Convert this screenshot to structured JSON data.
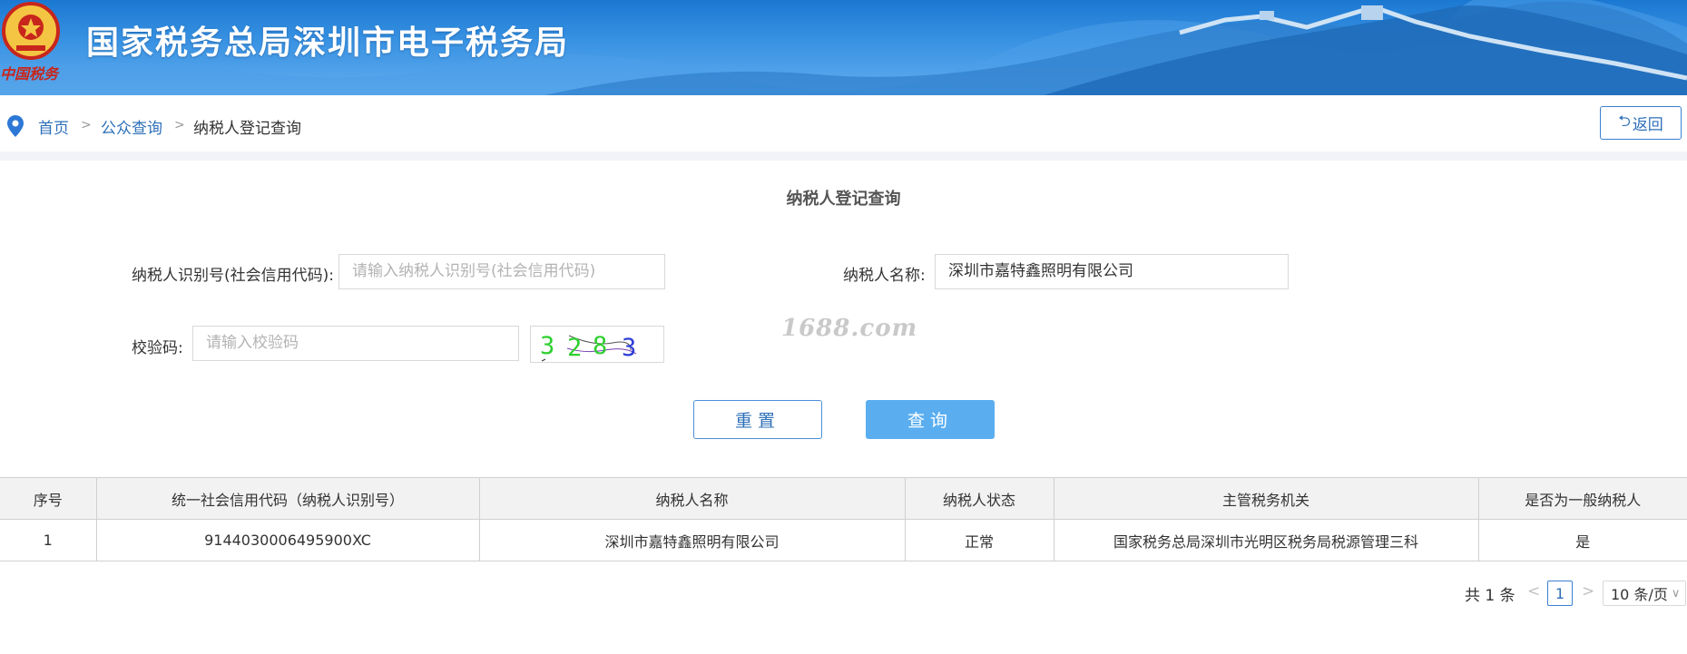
{
  "banner": {
    "title": "国家税务总局深圳市电子税务局",
    "mark_text": "中国税务"
  },
  "breadcrumb": {
    "items": [
      "首页",
      "公众查询",
      "纳税人登记查询"
    ],
    "separator": ">",
    "back_label": "返回",
    "back_icon": "undo-icon"
  },
  "form": {
    "title": "纳税人登记查询",
    "taxpayer_id_label": "纳税人识别号(社会信用代码):",
    "taxpayer_id_placeholder": "请输入纳税人识别号(社会信用代码)",
    "taxpayer_id_value": "",
    "taxpayer_name_label": "纳税人名称:",
    "taxpayer_name_value": "深圳市嘉特鑫照明有限公司",
    "captcha_label": "校验码:",
    "captcha_placeholder": "请输入校验码",
    "captcha_chars": [
      "3",
      "2",
      "8",
      "3"
    ],
    "captcha_colors": [
      "#2fcf2f",
      "#2fcf2f",
      "#2fcf2f",
      "#2f3fd8"
    ],
    "watermark": "1688.com",
    "reset_label": "重置",
    "query_label": "查询"
  },
  "table": {
    "headers": [
      "序号",
      "统一社会信用代码（纳税人识别号）",
      "纳税人名称",
      "纳税人状态",
      "主管税务机关",
      "是否为一般纳税人"
    ],
    "rows": [
      [
        "1",
        "9144030006495900XC",
        "深圳市嘉特鑫照明有限公司",
        "正常",
        "国家税务总局深圳市光明区税务局税源管理三科",
        "是"
      ]
    ]
  },
  "pagination": {
    "total": "共 1 条",
    "prev": "<",
    "current_page": "1",
    "next": ">",
    "page_size": "10 条/页"
  },
  "colors": {
    "banner": "#2a86dc",
    "accent": "#2d6fb8",
    "query_button": "#5aaef0"
  }
}
